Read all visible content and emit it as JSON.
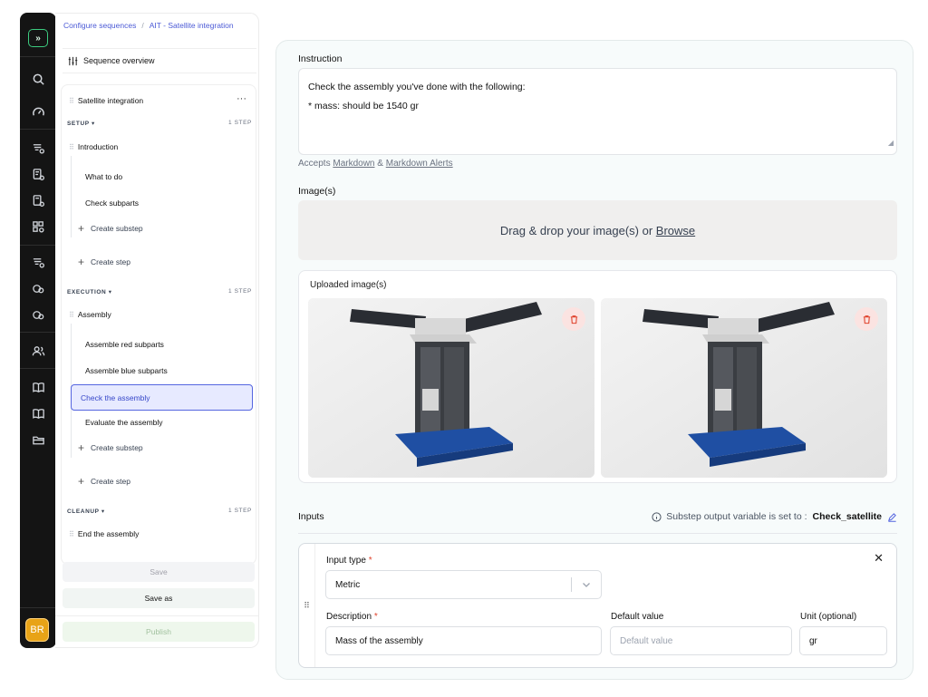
{
  "rail": {
    "expand_label": "»",
    "avatar_initials": "BR",
    "items": [
      "search-icon",
      "gauge-icon",
      "list-settings-icon",
      "document-settings-icon",
      "document-settings-icon",
      "grid-settings-icon",
      "list-settings-icon",
      "link-settings-icon",
      "link-settings-icon",
      "users-icon",
      "book-icon",
      "book-icon",
      "folder-icon"
    ]
  },
  "sidebar": {
    "breadcrumb": {
      "root": "Configure sequences",
      "separator": "/",
      "current": "AIT - Satellite integration"
    },
    "overview_label": "Sequence overview",
    "sequence_title": "Satellite integration",
    "menu_label": "···",
    "sections": [
      {
        "name": "SETUP ▾",
        "count": "1 STEP",
        "step": "Introduction",
        "substeps": [
          "What to do",
          "Check subparts"
        ],
        "create_substep": "Create substep",
        "create_step": "Create step"
      },
      {
        "name": "EXECUTION ▾",
        "count": "1 STEP",
        "step": "Assembly",
        "substeps": [
          "Assemble red subparts",
          "Assemble blue subparts",
          "Check the assembly",
          "Evaluate the assembly"
        ],
        "active_substep": "Check the assembly",
        "create_substep": "Create substep",
        "create_step": "Create step"
      },
      {
        "name": "CLEANUP ▾",
        "count": "1 STEP",
        "step": "End the assembly"
      }
    ],
    "save_label": "Save",
    "save_as_label": "Save as",
    "publish_label": "Publish"
  },
  "editor": {
    "instruction_label": "Instruction",
    "instruction_lines": [
      "Check the assembly you've done with the following:",
      "* mass: should be 1540 gr"
    ],
    "accepts_prefix": "Accepts",
    "accepts_link1": "Markdown",
    "accepts_amp": "&",
    "accepts_link2": "Markdown Alerts",
    "images_label": "Image(s)",
    "dropzone_text": "Drag & drop your image(s) or",
    "dropzone_link": "Browse",
    "uploaded_label": "Uploaded image(s)",
    "images": [
      {
        "alt": "satellite-structure-photo"
      },
      {
        "alt": "satellite-structure-photo"
      }
    ],
    "inputs_label": "Inputs",
    "output_var_text": "Substep output variable is set to :",
    "output_var_name": "Check_satellite",
    "input_card": {
      "input_type_label": "Input type",
      "input_type_value": "Metric",
      "description_label": "Description",
      "description_value": "Mass of the assembly",
      "default_label": "Default value",
      "default_placeholder": "Default value",
      "unit_label": "Unit (optional)",
      "unit_value": "gr",
      "required_mark": "*",
      "close_label": "✕",
      "drag_label": "⠿"
    }
  },
  "colors": {
    "accent": "#5566e0",
    "rail_bg": "#141414",
    "avatar": "#e8a317",
    "danger": "#e0442e"
  }
}
